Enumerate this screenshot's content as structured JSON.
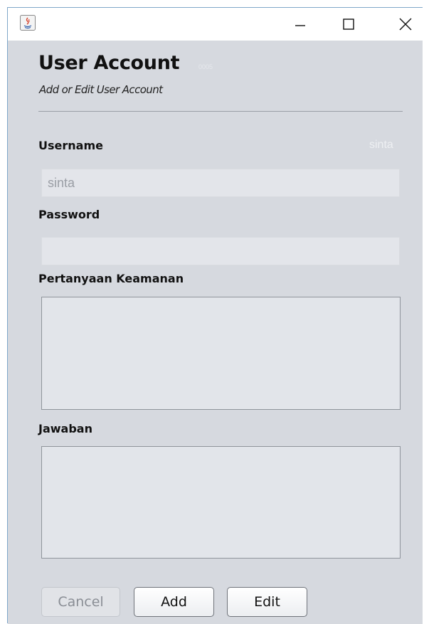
{
  "window": {
    "controls": {
      "minimize_icon": "minimize-icon",
      "maximize_icon": "maximize-icon",
      "close_icon": "close-icon"
    }
  },
  "header": {
    "title": "User Account",
    "code": "0005",
    "subtitle": "Add or Edit User Account"
  },
  "form": {
    "username": {
      "label": "Username",
      "echo": "sinta",
      "value": "sinta"
    },
    "password": {
      "label": "Password",
      "value": ""
    },
    "question": {
      "label": "Pertanyaan Keamanan",
      "value": ""
    },
    "answer": {
      "label": "Jawaban",
      "value": ""
    }
  },
  "buttons": {
    "cancel": "Cancel",
    "add": "Add",
    "edit": "Edit"
  },
  "colors": {
    "panel_bg": "#d6d9df",
    "field_bg": "#e3e5ea",
    "border_accent": "#7fa7c9"
  }
}
